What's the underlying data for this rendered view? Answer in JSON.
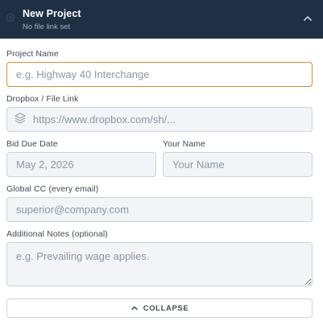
{
  "header": {
    "title": "New Project",
    "subtitle": "No file link set",
    "icon": "gear-icon",
    "toggle_icon": "chevron-up-icon"
  },
  "form": {
    "project_name": {
      "label": "Project Name",
      "value": "",
      "placeholder": "e.g. Highway 40 Interchange"
    },
    "file_link": {
      "label": "Dropbox / File Link",
      "value": "",
      "placeholder": "https://www.dropbox.com/sh/...",
      "icon": "layers-icon"
    },
    "bid_due_date": {
      "label": "Bid Due Date",
      "value": "",
      "placeholder": "May 2, 2026"
    },
    "your_name": {
      "label": "Your Name",
      "value": "",
      "placeholder": "Your Name"
    },
    "global_cc": {
      "label": "Global CC (every email)",
      "value": "",
      "placeholder": "superior@company.com"
    },
    "notes": {
      "label": "Additional Notes (optional)",
      "value": "",
      "placeholder": "e.g. Prevailing wage applies."
    }
  },
  "collapse_button": {
    "label": "COLLAPSE",
    "icon": "chevron-up-icon"
  },
  "colors": {
    "header_bg": "#1f3044",
    "focus_border": "#d98e2b",
    "field_bg": "#f2f4f7",
    "field_border": "#cbd3dc"
  }
}
